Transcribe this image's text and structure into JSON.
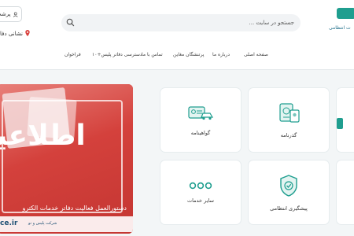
{
  "header": {
    "user_button_label": "پرشت",
    "address_link": "نشانی دفا",
    "search_placeholder": "جستجو در سایت ...",
    "logo_text": "ت انتظامی"
  },
  "nav": {
    "items": [
      "صفحه اصلی",
      "درباره ما",
      "پرتنشگان مغاین",
      "تماس با ما",
      "دسترسی دفاتر پلیس+۱۰",
      "فراخوان"
    ]
  },
  "banner": {
    "big_text": "اطلاعیه",
    "description": "دستورالعمل فعالیت دفاتر خدمات الکترو",
    "site": "ce.ir",
    "company": "شرکت پلیس و تو"
  },
  "services": [
    {
      "label": "گواهینامه",
      "icon": "car-license-icon"
    },
    {
      "label": "گذرنامه",
      "icon": "passport-icon"
    },
    {
      "label": "سایر خدمات",
      "icon": "more-dots-icon"
    },
    {
      "label": "پیشگیری انتظامی",
      "icon": "shield-check-icon"
    }
  ],
  "colors": {
    "accent": "#1f9e8f",
    "banner": "#d9423e"
  }
}
